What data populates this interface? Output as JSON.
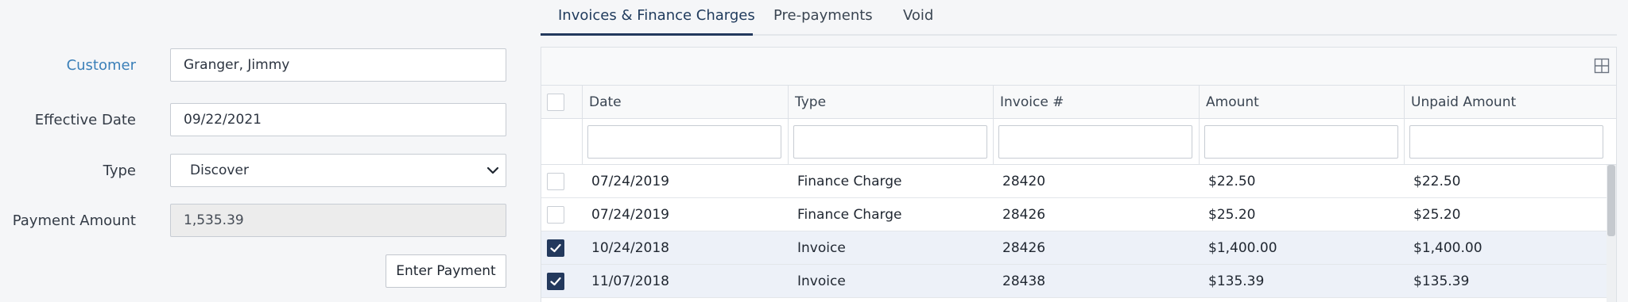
{
  "form": {
    "customer_label": "Customer",
    "customer_value": "Granger, Jimmy",
    "effective_date_label": "Effective Date",
    "effective_date_value": "09/22/2021",
    "type_label": "Type",
    "type_value": "Discover",
    "payment_amount_label": "Payment Amount",
    "payment_amount_value": "1,535.39",
    "enter_payment_label": "Enter Payment"
  },
  "tabs": [
    {
      "label": "Invoices & Finance Charges",
      "active": true
    },
    {
      "label": "Pre-payments",
      "active": false
    },
    {
      "label": "Void",
      "active": false
    }
  ],
  "grid": {
    "columns": [
      "Date",
      "Type",
      "Invoice #",
      "Amount",
      "Unpaid Amount"
    ],
    "rows": [
      {
        "checked": false,
        "date": "07/24/2019",
        "type": "Finance Charge",
        "invoice": "28420",
        "amount": "$22.50",
        "unpaid": "$22.50"
      },
      {
        "checked": false,
        "date": "07/24/2019",
        "type": "Finance Charge",
        "invoice": "28426",
        "amount": "$25.20",
        "unpaid": "$25.20"
      },
      {
        "checked": true,
        "date": "10/24/2018",
        "type": "Invoice",
        "invoice": "28426",
        "amount": "$1,400.00",
        "unpaid": "$1,400.00"
      },
      {
        "checked": true,
        "date": "11/07/2018",
        "type": "Invoice",
        "invoice": "28438",
        "amount": "$135.39",
        "unpaid": "$135.39"
      }
    ]
  },
  "icons": {
    "layout": "grid-layout-icon",
    "select_chevron": "chevron-down-icon",
    "check": "checkmark-icon"
  },
  "colors": {
    "accent": "#23395d",
    "link": "#3a7fb8",
    "selected_row": "#edf1f8"
  }
}
